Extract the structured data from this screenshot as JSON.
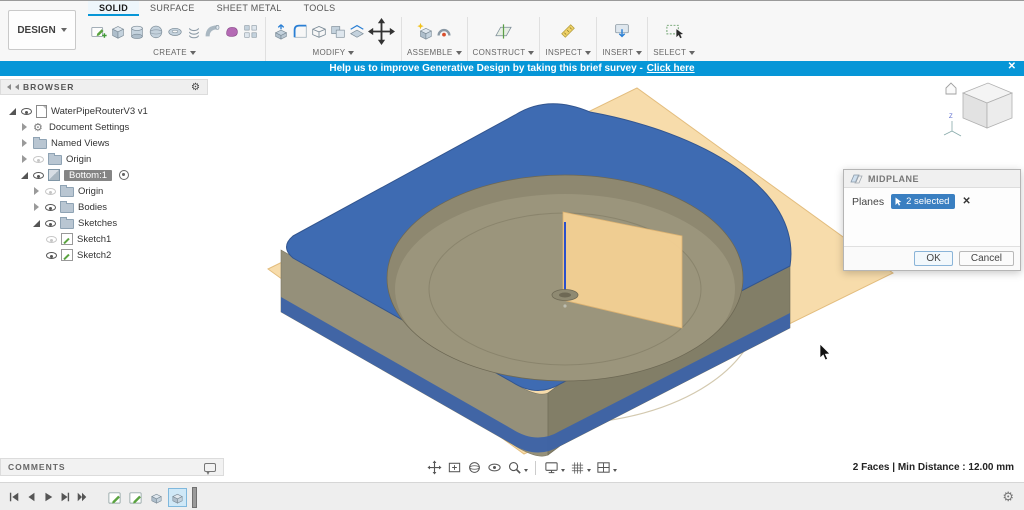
{
  "toolbar": {
    "design_button_label": "DESIGN",
    "tabs": [
      {
        "label": "SOLID",
        "active": true
      },
      {
        "label": "SURFACE",
        "active": false
      },
      {
        "label": "SHEET METAL",
        "active": false
      },
      {
        "label": "TOOLS",
        "active": false
      }
    ],
    "groups": [
      {
        "label": "CREATE",
        "icons": [
          "create-sketch",
          "box",
          "cylinder",
          "sphere",
          "torus",
          "coil",
          "pipe",
          "create-form",
          "pattern"
        ]
      },
      {
        "label": "MODIFY",
        "icons": [
          "press-pull",
          "fillet",
          "shell",
          "combine",
          "offset-face",
          "move"
        ]
      },
      {
        "label": "ASSEMBLE",
        "icons": [
          "new-component",
          "joint"
        ]
      },
      {
        "label": "CONSTRUCT",
        "icons": [
          "midplane"
        ]
      },
      {
        "label": "INSPECT",
        "icons": [
          "measure"
        ]
      },
      {
        "label": "INSERT",
        "icons": [
          "insert"
        ]
      },
      {
        "label": "SELECT",
        "icons": [
          "select"
        ]
      }
    ]
  },
  "banner": {
    "message": "Help us to improve Generative Design by taking this brief survey -",
    "link_text": "Click here",
    "close_label": "✕"
  },
  "browser": {
    "title": "BROWSER",
    "items": [
      {
        "label": "WaterPipeRouterV3 v1"
      },
      {
        "label": "Document Settings"
      },
      {
        "label": "Named Views"
      },
      {
        "label": "Origin"
      },
      {
        "label": "Bottom:1"
      },
      {
        "label": "Origin"
      },
      {
        "label": "Bodies"
      },
      {
        "label": "Sketches"
      },
      {
        "label": "Sketch1"
      },
      {
        "label": "Sketch2"
      }
    ]
  },
  "dialog": {
    "title": "MIDPLANE",
    "field_label": "Planes",
    "selection_badge": "2 selected",
    "close_label": "✕",
    "ok_label": "OK",
    "cancel_label": "Cancel"
  },
  "statusbar": {
    "selection_info": "2 Faces | Min Distance : 12.00 mm"
  },
  "comments": {
    "title": "COMMENTS"
  },
  "colors": {
    "accent": "#0696d7",
    "part_blue": "#3e6bb2",
    "plane_tan": "#f6d9a4",
    "selected_row": "#858585"
  }
}
